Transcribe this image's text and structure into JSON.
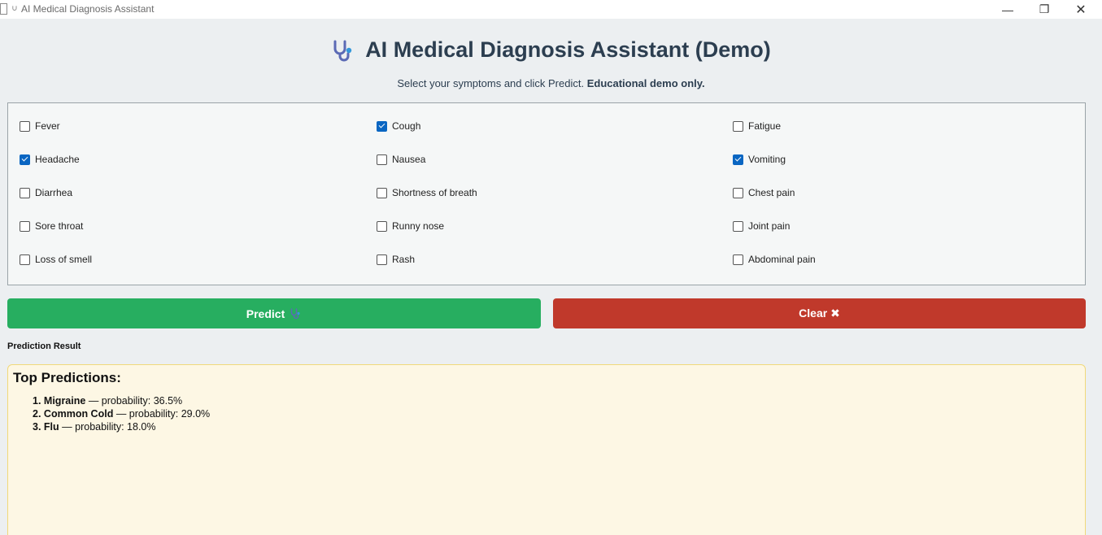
{
  "window": {
    "title": "AI Medical Diagnosis Assistant",
    "controls": {
      "minimize": "—",
      "maximize": "❐",
      "close": "✕"
    }
  },
  "header": {
    "title": "AI Medical Diagnosis Assistant (Demo)",
    "subtitle_text": "Select your symptoms and click Predict.",
    "subtitle_bold": "Educational demo only."
  },
  "symptoms": [
    {
      "label": "Fever",
      "checked": false
    },
    {
      "label": "Cough",
      "checked": true
    },
    {
      "label": "Fatigue",
      "checked": false
    },
    {
      "label": "Headache",
      "checked": true
    },
    {
      "label": "Nausea",
      "checked": false
    },
    {
      "label": "Vomiting",
      "checked": true
    },
    {
      "label": "Diarrhea",
      "checked": false
    },
    {
      "label": "Shortness of breath",
      "checked": false
    },
    {
      "label": "Chest pain",
      "checked": false
    },
    {
      "label": "Sore throat",
      "checked": false
    },
    {
      "label": "Runny nose",
      "checked": false
    },
    {
      "label": "Joint pain",
      "checked": false
    },
    {
      "label": "Loss of smell",
      "checked": false
    },
    {
      "label": "Rash",
      "checked": false
    },
    {
      "label": "Abdominal pain",
      "checked": false
    }
  ],
  "buttons": {
    "predict_label": "Predict",
    "clear_label": "Clear ✖",
    "predict_color": "#27ae60",
    "clear_color": "#c0392b"
  },
  "result": {
    "section_label": "Prediction Result",
    "heading": "Top Predictions:",
    "predictions": [
      {
        "rank": "1.",
        "name": "Migraine",
        "detail": "— probability: 36.5%"
      },
      {
        "rank": "2.",
        "name": "Common Cold",
        "detail": "— probability: 29.0%"
      },
      {
        "rank": "3.",
        "name": "Flu",
        "detail": "— probability: 18.0%"
      }
    ]
  },
  "icons": {
    "title_icon": "stethoscope-icon",
    "predict_icon": "stethoscope-icon"
  }
}
